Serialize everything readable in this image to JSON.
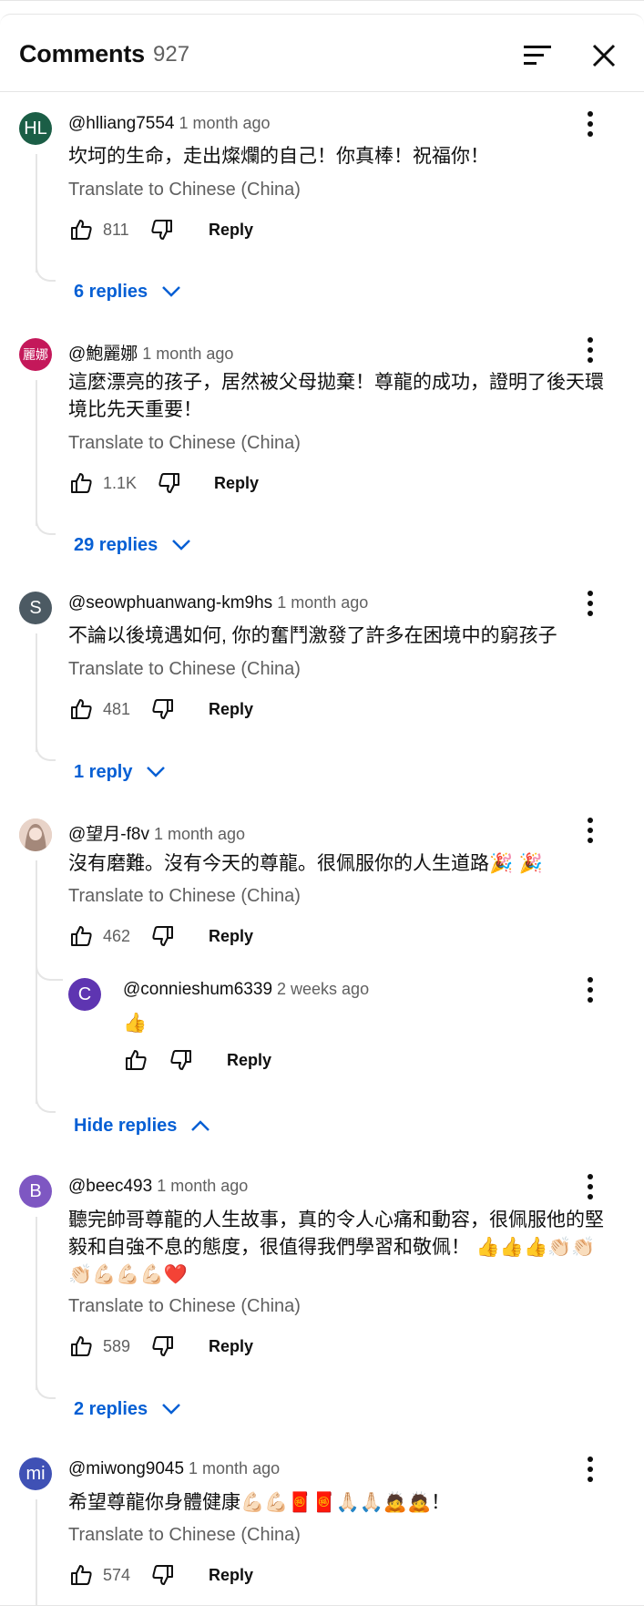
{
  "header": {
    "title": "Comments",
    "count": "927"
  },
  "common": {
    "translate": "Translate to Chinese (China)",
    "reply": "Reply"
  },
  "comments": [
    {
      "handle": "@hlliang7554",
      "time": "1 month ago",
      "avatar_text": "HL",
      "avatar_color": "#1b5e46",
      "text": "坎坷的生命，走出燦爛的自己！你真棒！祝福你！",
      "likes": "811",
      "replies_label": "6 replies"
    },
    {
      "handle": "@鮑麗娜",
      "time": "1 month ago",
      "avatar_text": "麗娜",
      "avatar_color": "#c4185a",
      "text": "這麼漂亮的孩子，居然被父母拋棄！尊龍的成功，證明了後天環境比先天重要！",
      "likes": "1.1K",
      "replies_label": "29 replies"
    },
    {
      "handle": "@seowphuanwang-km9hs",
      "time": "1 month ago",
      "avatar_text": "S",
      "avatar_color": "#4c5a63",
      "text": "不論以後境遇如何, 你的奮鬥激發了許多在困境中的窮孩子",
      "likes": "481",
      "replies_label": "1 reply"
    },
    {
      "handle": "@望月-f8v",
      "time": "1 month ago",
      "avatar_text": "",
      "avatar_color": "#d9b8a8",
      "text": "沒有磨難。沒有今天的尊龍。很佩服你的人生道路🎉 🎉",
      "likes": "462",
      "reply": {
        "handle": "@connieshum6339",
        "time": "2 weeks ago",
        "avatar_text": "C",
        "avatar_color": "#5e35b1",
        "text": "👍"
      },
      "replies_label": "Hide replies"
    },
    {
      "handle": "@beec493",
      "time": "1 month ago",
      "avatar_text": "B",
      "avatar_color": "#7e57c2",
      "text": "聽完帥哥尊龍的人生故事，真的令人心痛和動容，很佩服他的堅毅和自強不息的態度，很值得我們學習和敬佩！ 👍👍👍👏🏻👏🏻👏🏻💪🏻💪🏻💪🏻❤️",
      "likes": "589",
      "replies_label": "2 replies"
    },
    {
      "handle": "@miwong9045",
      "time": "1 month ago",
      "avatar_text": "mi",
      "avatar_color": "#3f51b5",
      "text": "希望尊龍你身體健康💪🏻💪🏻🧧🧧🙏🏻🙏🏻🙇🙇！",
      "likes": "574"
    }
  ]
}
